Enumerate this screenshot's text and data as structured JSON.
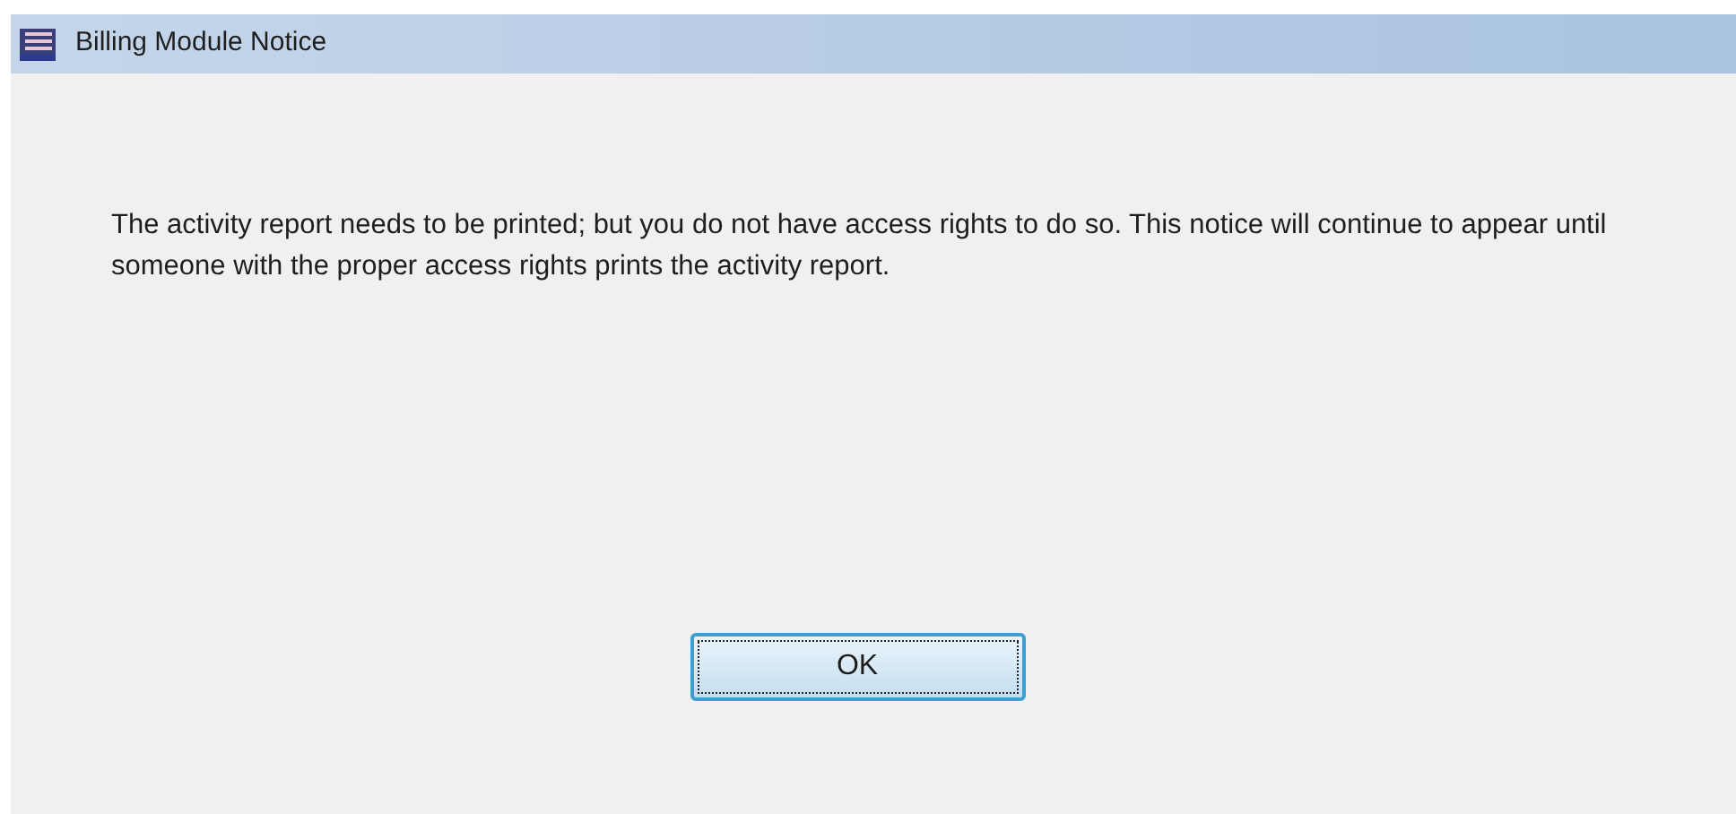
{
  "window": {
    "title": "Billing Module Notice"
  },
  "message": "The activity report needs to be printed; but you do not have access rights to do so.  This notice will continue to appear until someone with the proper access rights prints the activity report.",
  "buttons": [
    {
      "label": "OK",
      "selected": true
    }
  ]
}
